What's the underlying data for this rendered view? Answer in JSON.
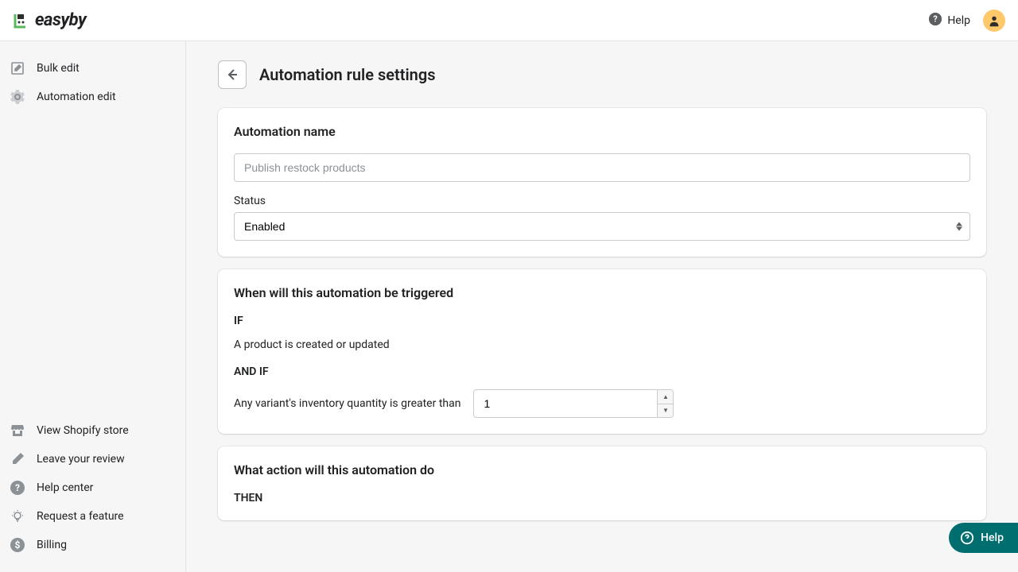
{
  "header": {
    "logo_text": "easyby",
    "help_label": "Help"
  },
  "sidebar": {
    "top": [
      {
        "label": "Bulk edit",
        "icon": "edit-icon"
      },
      {
        "label": "Automation edit",
        "icon": "gear-icon"
      }
    ],
    "bottom": [
      {
        "label": "View Shopify store",
        "icon": "store-icon"
      },
      {
        "label": "Leave your review",
        "icon": "pencil-icon"
      },
      {
        "label": "Help center",
        "icon": "question-icon"
      },
      {
        "label": "Request a feature",
        "icon": "lightbulb-icon"
      },
      {
        "label": "Billing",
        "icon": "dollar-icon"
      }
    ]
  },
  "page": {
    "title": "Automation rule settings",
    "name_section": {
      "heading": "Automation name",
      "placeholder": "Publish restock products",
      "status_label": "Status",
      "status_value": "Enabled"
    },
    "trigger_section": {
      "heading": "When will this automation be triggered",
      "if_label": "IF",
      "if_text": "A product is created or updated",
      "andif_label": "AND IF",
      "andif_text": "Any variant's inventory quantity is greater than",
      "quantity_value": "1"
    },
    "action_section": {
      "heading": "What action will this automation do",
      "then_label": "THEN"
    }
  },
  "fab": {
    "label": "Help"
  }
}
